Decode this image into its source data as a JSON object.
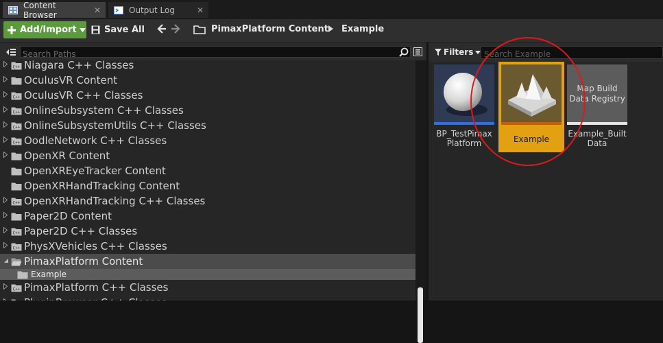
{
  "tabs": [
    {
      "label": "Content Browser",
      "active": true
    },
    {
      "label": "Output Log",
      "active": false
    }
  ],
  "tab_close_glyph": "✕",
  "toolbar": {
    "add_import_label": "Add/Import",
    "save_all_label": "Save All",
    "breadcrumb": [
      "PimaxPlatform Content",
      "Example"
    ]
  },
  "sources": {
    "search_placeholder": "Search Paths",
    "tree_items": [
      {
        "label": "Niagara C++ Classes",
        "kind": "cpp",
        "expandable": true
      },
      {
        "label": "OculusVR Content",
        "kind": "folder",
        "expandable": true
      },
      {
        "label": "OculusVR C++ Classes",
        "kind": "cpp",
        "expandable": true
      },
      {
        "label": "OnlineSubsystem C++ Classes",
        "kind": "cpp",
        "expandable": true
      },
      {
        "label": "OnlineSubsystemUtils C++ Classes",
        "kind": "cpp",
        "expandable": true
      },
      {
        "label": "OodleNetwork C++ Classes",
        "kind": "cpp",
        "expandable": true
      },
      {
        "label": "OpenXR Content",
        "kind": "folder",
        "expandable": true
      },
      {
        "label": "OpenXREyeTracker Content",
        "kind": "folder",
        "expandable": false
      },
      {
        "label": "OpenXRHandTracking Content",
        "kind": "folder",
        "expandable": false
      },
      {
        "label": "OpenXRHandTracking C++ Classes",
        "kind": "cpp",
        "expandable": true
      },
      {
        "label": "Paper2D Content",
        "kind": "folder",
        "expandable": true
      },
      {
        "label": "Paper2D C++ Classes",
        "kind": "cpp",
        "expandable": true
      },
      {
        "label": "PhysXVehicles C++ Classes",
        "kind": "cpp",
        "expandable": true
      },
      {
        "label": "PimaxPlatform Content",
        "kind": "folder-open",
        "expandable": true,
        "expanded": true,
        "selected": true
      },
      {
        "label": "Example",
        "kind": "folder",
        "expandable": false,
        "child": true,
        "selected": true
      },
      {
        "label": "PimaxPlatform C++ Classes",
        "kind": "cpp",
        "expandable": true
      },
      {
        "label": "PluginBrowser C++ Classes",
        "kind": "cpp",
        "expandable": true
      }
    ]
  },
  "assets": {
    "filters_label": "Filters",
    "search_placeholder": "Search Example",
    "items": [
      {
        "name": "BP_TestPimax Platform",
        "type_color": "#2f6fe0"
      },
      {
        "name": "Example",
        "type_color": "#c45c12",
        "selected": true
      },
      {
        "name": "Example_Built Data",
        "thumb_text": "Map Build Data Registry",
        "type_color": "#e6e6e6"
      }
    ]
  },
  "colors": {
    "accent_green": "#5a9c3a",
    "selection_gold": "#e3a112",
    "annotation_red": "#e01818"
  }
}
